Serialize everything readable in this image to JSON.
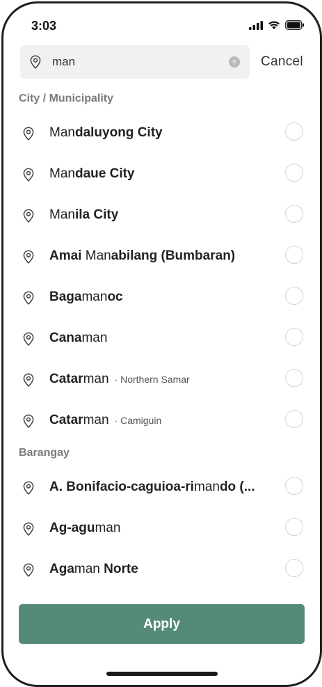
{
  "status_bar": {
    "time": "3:03"
  },
  "search": {
    "value": "man",
    "clear_label": "×",
    "cancel_label": "Cancel"
  },
  "sections": {
    "city": "City / Municipality",
    "barangay": "Barangay"
  },
  "city_items": [
    {
      "segments": [
        {
          "t": "Man",
          "b": false
        },
        {
          "t": "daluyong City",
          "b": true
        }
      ],
      "sub": ""
    },
    {
      "segments": [
        {
          "t": "Man",
          "b": false
        },
        {
          "t": "daue City",
          "b": true
        }
      ],
      "sub": ""
    },
    {
      "segments": [
        {
          "t": "Man",
          "b": false
        },
        {
          "t": "ila City",
          "b": true
        }
      ],
      "sub": ""
    },
    {
      "segments": [
        {
          "t": "Amai ",
          "b": true
        },
        {
          "t": "Man",
          "b": false
        },
        {
          "t": "abilang (Bumbaran)",
          "b": true
        }
      ],
      "sub": ""
    },
    {
      "segments": [
        {
          "t": "Baga",
          "b": true
        },
        {
          "t": "man",
          "b": false
        },
        {
          "t": "oc",
          "b": true
        }
      ],
      "sub": ""
    },
    {
      "segments": [
        {
          "t": "Cana",
          "b": true
        },
        {
          "t": "man",
          "b": false
        }
      ],
      "sub": ""
    },
    {
      "segments": [
        {
          "t": "Catar",
          "b": true
        },
        {
          "t": "man",
          "b": false
        }
      ],
      "sub": "· Northern Samar"
    },
    {
      "segments": [
        {
          "t": "Catar",
          "b": true
        },
        {
          "t": "man",
          "b": false
        }
      ],
      "sub": "· Camiguin"
    }
  ],
  "barangay_items": [
    {
      "segments": [
        {
          "t": "A. Bonifacio-caguioa-ri",
          "b": true
        },
        {
          "t": "man",
          "b": false
        },
        {
          "t": "do (...",
          "b": true
        }
      ],
      "sub": ""
    },
    {
      "segments": [
        {
          "t": "Ag-agu",
          "b": true
        },
        {
          "t": "man",
          "b": false
        }
      ],
      "sub": ""
    },
    {
      "segments": [
        {
          "t": "Aga",
          "b": true
        },
        {
          "t": "man ",
          "b": false
        },
        {
          "t": "Norte",
          "b": true
        }
      ],
      "sub": ""
    }
  ],
  "apply_label": "Apply",
  "colors": {
    "accent": "#558a78",
    "section_header": "#7b7b7b",
    "radio_border": "#d4d4d4"
  }
}
